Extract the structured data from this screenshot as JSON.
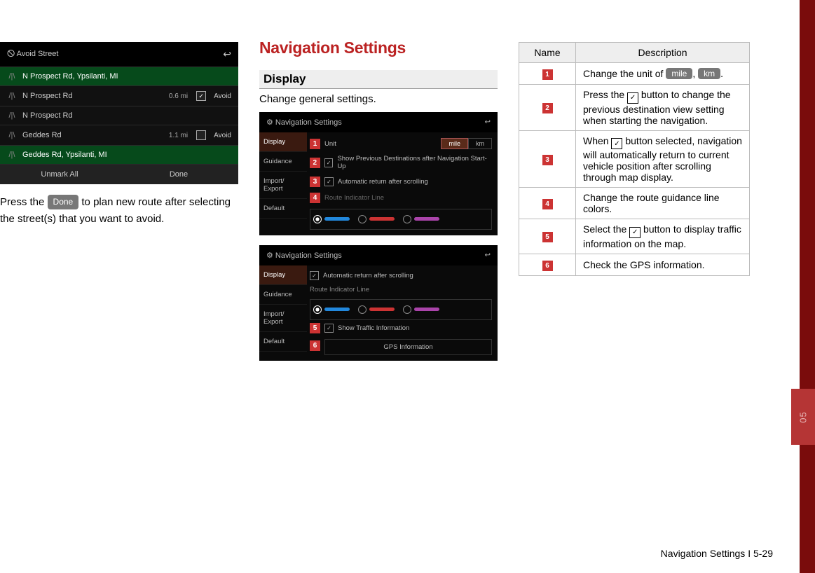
{
  "col1": {
    "avoid_title": "Avoid Street",
    "rows": [
      {
        "name": "N Prospect Rd, Ypsilanti, MI",
        "dist": "",
        "checked": true,
        "selected": true
      },
      {
        "name": "N Prospect Rd",
        "dist": "0.6 mi",
        "checked": true,
        "selected": false,
        "avoid_label": "Avoid"
      },
      {
        "name": "N Prospect Rd",
        "dist": "",
        "checked": false,
        "selected": false
      },
      {
        "name": "Geddes Rd",
        "dist": "1.1 mi",
        "checked": false,
        "selected": false,
        "avoid_label": "Avoid"
      },
      {
        "name": "Geddes Rd, Ypsilanti, MI",
        "dist": "",
        "checked": false,
        "selected": true
      }
    ],
    "unmark": "Unmark All",
    "done": "Done",
    "caption_a": "Press the ",
    "caption_btn": "Done",
    "caption_b": " to plan new route after selecting the street(s) that you want to avoid."
  },
  "col2": {
    "heading": "Navigation Settings",
    "sub": "Display",
    "sub_caption": "Change general settings.",
    "panel_title": "Navigation Settings",
    "sidebar": [
      "Display",
      "Guidance",
      "Import/\nExport",
      "Default"
    ],
    "p1": {
      "unit_label": "Unit",
      "mile": "mile",
      "km": "km",
      "show_prev": "Show Previous Destinations after Navigation Start-Up",
      "auto_return": "Automatic return after scrolling",
      "route_line": "Route Indicator Line"
    },
    "p2": {
      "auto_return": "Automatic return after scrolling",
      "route_line": "Route Indicator Line",
      "show_traffic": "Show Traffic Information",
      "gps": "GPS Information"
    },
    "nums": {
      "n1": "1",
      "n2": "2",
      "n3": "3",
      "n4": "4",
      "n5": "5",
      "n6": "6"
    }
  },
  "col3": {
    "th_name": "Name",
    "th_desc": "Description",
    "rows": [
      {
        "n": "1",
        "d_a": "Change the unit of ",
        "pill1": "mile",
        "d_b": ", ",
        "pill2": "km",
        "d_c": "."
      },
      {
        "n": "2",
        "d_a": "Press the ",
        "cb": true,
        "d_b": " button to change the previous destination view setting when starting the navigation."
      },
      {
        "n": "3",
        "d_a": "When ",
        "cb": true,
        "d_b": " button selected, navigation will automatically return to current vehicle position after scrolling through map display."
      },
      {
        "n": "4",
        "d_a": "Change the route guidance line colors."
      },
      {
        "n": "5",
        "d_a": "Select the ",
        "cb": true,
        "d_b": " button to display traffic information on the map."
      },
      {
        "n": "6",
        "d_a": "Check the GPS information."
      }
    ]
  },
  "footer": "Navigation Settings I 5-29",
  "section_num": "05"
}
